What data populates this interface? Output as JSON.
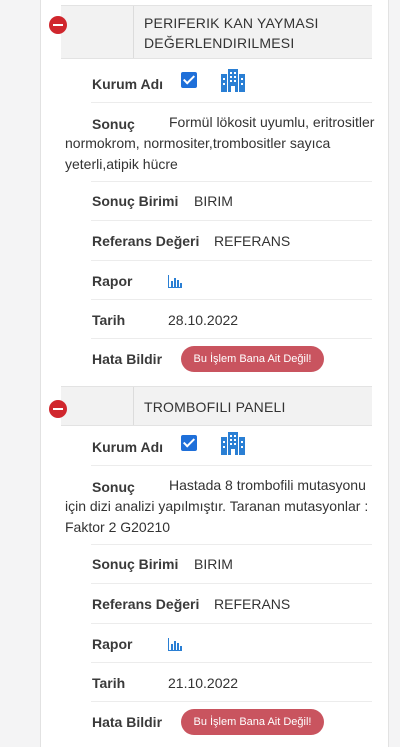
{
  "panels": [
    {
      "title_line1": "PERIFERIK KAN YAYMASI",
      "title_line2": "DEĞERLENDIRILMESI",
      "kurum_label": "Kurum Adı",
      "kurum_checked": true,
      "sonuc_label": "Sonuç",
      "sonuc_value": "Formül lökosit uyumlu, eritrositler normokrom, normositer,trombositler sayıca yeterli,atipik hücre",
      "birim_label": "Sonuç Birimi",
      "birim_value": "BIRIM",
      "referans_label": "Referans Değeri",
      "referans_value": "REFERANS",
      "rapor_label": "Rapor",
      "tarih_label": "Tarih",
      "tarih_value": "28.10.2022",
      "hata_label": "Hata Bildir",
      "hata_button": "Bu İşlem Bana Ait Değil!"
    },
    {
      "title_line1": "TROMBOFILI PANELI",
      "kurum_label": "Kurum Adı",
      "kurum_checked": true,
      "sonuc_label": "Sonuç",
      "sonuc_value": "Hastada 8 trombofili mutasyonu için dizi analizi yapılmıştır. Taranan mutasyonlar : Faktor 2 G20210",
      "birim_label": "Sonuç Birimi",
      "birim_value": "BIRIM",
      "referans_label": "Referans Değeri",
      "referans_value": "REFERANS",
      "rapor_label": "Rapor",
      "tarih_label": "Tarih",
      "tarih_value": "21.10.2022",
      "hata_label": "Hata Bildir",
      "hata_button": "Bu İşlem Bana Ait Değil!"
    }
  ],
  "colors": {
    "remove": "#d0262d",
    "checkbox": "#1e6fd9",
    "report_button": "#c9545f",
    "icon_blue": "#2a7fd4"
  },
  "icons": {
    "remove": "minus-circle-icon",
    "institution": "building-icon",
    "report": "bar-chart-icon"
  }
}
